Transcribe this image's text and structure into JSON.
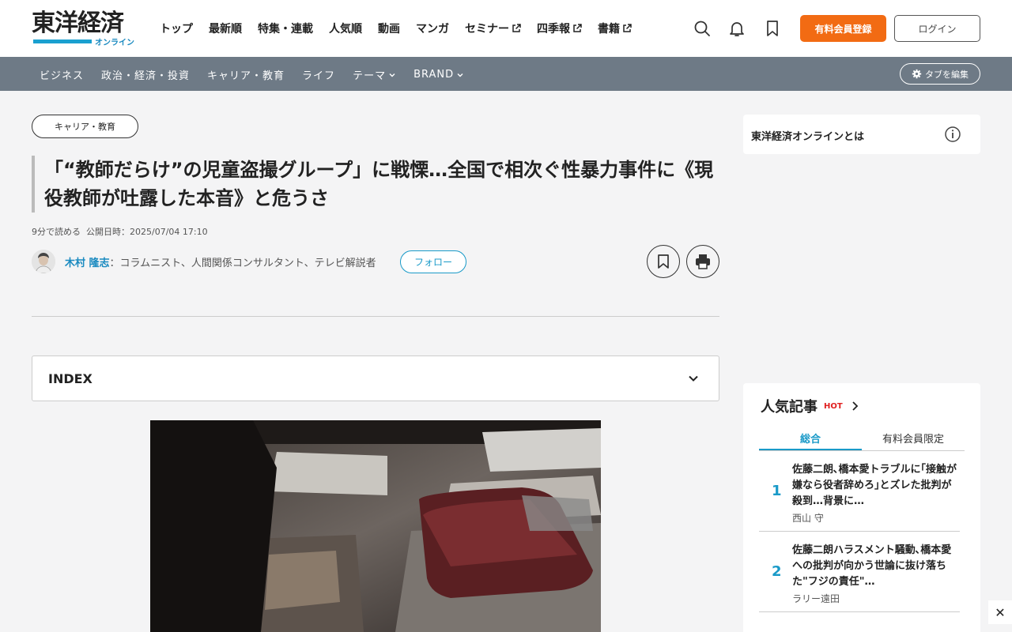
{
  "header": {
    "logo_main": "東洋経済",
    "logo_sub": "オンライン",
    "nav": [
      {
        "label": "トップ",
        "external": false
      },
      {
        "label": "最新順",
        "external": false
      },
      {
        "label": "特集・連載",
        "external": false
      },
      {
        "label": "人気順",
        "external": false
      },
      {
        "label": "動画",
        "external": false
      },
      {
        "label": "マンガ",
        "external": false
      },
      {
        "label": "セミナー",
        "external": true
      },
      {
        "label": "四季報",
        "external": true
      },
      {
        "label": "書籍",
        "external": true
      }
    ],
    "register_label": "有料会員登録",
    "login_label": "ログイン"
  },
  "subnav": {
    "items": [
      {
        "label": "ビジネス",
        "dropdown": false
      },
      {
        "label": "政治・経済・投資",
        "dropdown": false
      },
      {
        "label": "キャリア・教育",
        "dropdown": false
      },
      {
        "label": "ライフ",
        "dropdown": false
      },
      {
        "label": "テーマ",
        "dropdown": true
      },
      {
        "label": "BRAND",
        "dropdown": true
      }
    ],
    "tab_edit_label": "タブを編集"
  },
  "article": {
    "category": "キャリア・教育",
    "title": "「“教師だらけ”の児童盗撮グループ」に戦慄…全国で相次ぐ性暴力事件に《現役教師が吐露した本音》と危うさ",
    "read_time": "9分で読める",
    "published": "公開日時：2025/07/04 17:10",
    "author_name": "木村 隆志",
    "author_role": "：コラムニスト、人間関係コンサルタント、テレビ解説者",
    "follow_label": "フォロー",
    "index_label": "INDEX"
  },
  "sidebar": {
    "about_label": "東洋経済オンラインとは",
    "popular_title": "人気記事",
    "popular_badge": "HOT",
    "tabs": [
      "総合",
      "有料会員限定"
    ],
    "ranking": [
      {
        "rank": "1",
        "title": "佐藤二朗､橋本愛トラブルに｢接触が嫌なら役者辞めろ｣とズレた批判が殺到…背景に…",
        "author": "西山 守"
      },
      {
        "rank": "2",
        "title": "佐藤二朗ハラスメント騒動､橋本愛への批判が向かう世論に抜け落ちた\"フジの責任\"…",
        "author": "ラリー遠田"
      }
    ]
  },
  "colors": {
    "accent_blue": "#1a9ac8",
    "register_orange": "#f26b13",
    "subnav_gray": "#6e7a86",
    "hot_red": "#e02020"
  }
}
